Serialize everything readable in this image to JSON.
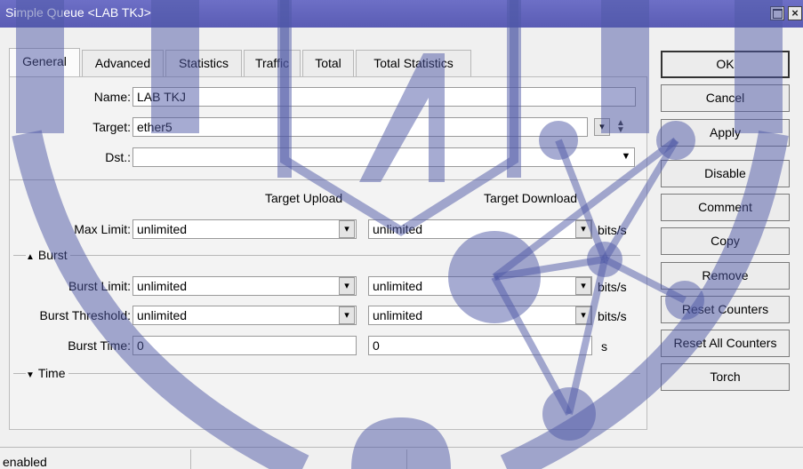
{
  "window": {
    "title": "Simple Queue <LAB TKJ>"
  },
  "tabs": [
    "General",
    "Advanced",
    "Statistics",
    "Traffic",
    "Total",
    "Total Statistics"
  ],
  "fields": {
    "name": {
      "label": "Name:",
      "value": "LAB TKJ"
    },
    "target": {
      "label": "Target:",
      "value": "ether5"
    },
    "dst": {
      "label": "Dst.:",
      "value": ""
    }
  },
  "columns": {
    "upload": "Target Upload",
    "download": "Target Download"
  },
  "max_limit": {
    "label": "Max Limit:",
    "upload": "unlimited",
    "download": "unlimited",
    "unit": "bits/s"
  },
  "burst": {
    "title": "Burst",
    "limit": {
      "label": "Burst Limit:",
      "upload": "unlimited",
      "download": "unlimited",
      "unit": "bits/s"
    },
    "threshold": {
      "label": "Burst Threshold:",
      "upload": "unlimited",
      "download": "unlimited",
      "unit": "bits/s"
    },
    "time": {
      "label": "Burst Time:",
      "upload": "0",
      "download": "0",
      "unit": "s"
    }
  },
  "time_section": {
    "title": "Time"
  },
  "buttons": [
    "OK",
    "Cancel",
    "Apply",
    "Disable",
    "Comment",
    "Copy",
    "Remove",
    "Reset Counters",
    "Reset All Counters",
    "Torch"
  ],
  "status": "enabled",
  "colors": {
    "titlebar": "#5f61bb",
    "watermark": "#4e57a6"
  }
}
